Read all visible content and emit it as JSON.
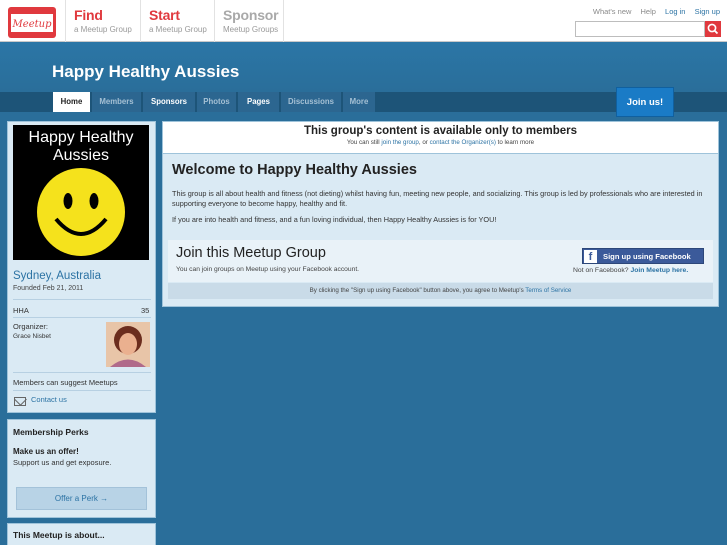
{
  "topbar": {
    "logo_text": "Meetup",
    "nav": [
      {
        "title": "Find",
        "subtitle": "a Meetup Group"
      },
      {
        "title": "Start",
        "subtitle": "a Meetup Group"
      },
      {
        "title": "Sponsor",
        "subtitle": "Meetup Groups"
      }
    ],
    "links": {
      "whats_new": "What's new",
      "help": "Help",
      "login": "Log in",
      "signup": "Sign up"
    },
    "search": {
      "value": "",
      "placeholder": "",
      "icon": "search-icon"
    }
  },
  "group": {
    "title": "Happy Healthy Aussies",
    "tabs": [
      "Home",
      "Members",
      "Sponsors",
      "Photos",
      "Pages",
      "Discussions",
      "More"
    ],
    "join_button": "Join us!"
  },
  "sidebar": {
    "photo_title": "Happy Healthy Aussies",
    "location": "Sydney, Australia",
    "founded": "Founded Feb 21, 2011",
    "member_label": "HHA",
    "member_count": "35",
    "organizer_label": "Organizer:",
    "organizer_name": "Grace Nisbet",
    "suggest": "Members can suggest Meetups",
    "contact": "Contact us",
    "perks": {
      "title": "Membership Perks",
      "offer": "Make us an offer!",
      "sub": "Support us and get exposure.",
      "button": "Offer a Perk →"
    },
    "about_title": "This Meetup is about..."
  },
  "notice": {
    "title": "This group's content is available only to members",
    "sub_pre": "You can still",
    "sub_link1": "join the group",
    "sub_mid": ", or",
    "sub_link2": "contact the Organizer(s)",
    "sub_post": "to learn more"
  },
  "main": {
    "welcome": "Welcome to Happy Healthy Aussies",
    "desc1": "This group is all about health and fitness (not dieting) whilst having fun, meeting new people, and socializing. This group is led by professionals who are interested in supporting everyone to become happy, healthy and fit.",
    "desc2": "If you are into health and fitness, and a fun loving individual, then Happy Healthy Aussies is for YOU!",
    "join_title": "Join this Meetup Group",
    "join_sub": "You can join groups on Meetup using your Facebook account.",
    "fb_button": "Sign up using Facebook",
    "not_fb_pre": "Not on Facebook?",
    "not_fb_link": "Join Meetup here.",
    "agree_pre": "By clicking the \"Sign up using Facebook\" button above, you agree to Meetup's",
    "agree_link": "Terms of Service"
  }
}
